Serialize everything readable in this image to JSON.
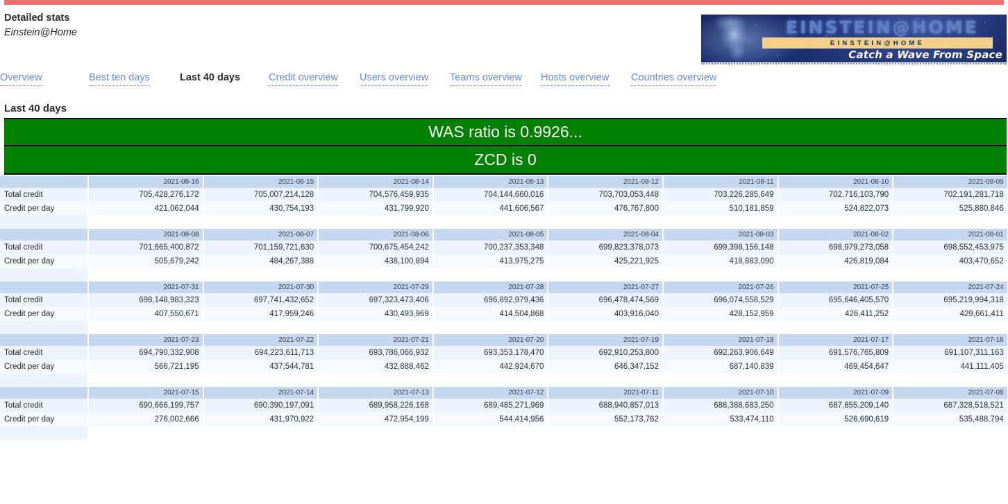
{
  "header": {
    "title": "Detailed stats",
    "subtitle": "Einstein@Home"
  },
  "banner": {
    "wordmark": "EINSTEIN@HOME",
    "bar_text": "EINSTEIN@HOME",
    "tagline": "Catch a Wave From Space"
  },
  "nav": {
    "items": [
      {
        "label": "Overview",
        "active": false
      },
      {
        "label": "Best ten days",
        "active": false
      },
      {
        "label": "Last 40 days",
        "active": true
      },
      {
        "label": "Credit overview",
        "active": false
      },
      {
        "label": "Users overview",
        "active": false
      },
      {
        "label": "Teams overview",
        "active": false
      },
      {
        "label": "Hosts overview",
        "active": false
      },
      {
        "label": "Countries overview",
        "active": false
      }
    ]
  },
  "page_title": "Last 40 days",
  "status_banners": [
    {
      "text": "WAS ratio is 0.9926...",
      "color": "#008000"
    },
    {
      "text": "ZCD is 0",
      "color": "#008000"
    }
  ],
  "table": {
    "row_labels": [
      "Total credit",
      "Credit per day"
    ],
    "blocks": [
      {
        "dates": [
          "2021-08-16",
          "2021-08-15",
          "2021-08-14",
          "2021-08-13",
          "2021-08-12",
          "2021-08-11",
          "2021-08-10",
          "2021-08-09"
        ],
        "total_credit": [
          "705,428,276,172",
          "705,007,214,128",
          "704,576,459,935",
          "704,144,660,016",
          "703,703,053,448",
          "703,226,285,649",
          "702,716,103,790",
          "702,191,281,718"
        ],
        "credit_per_day": [
          "421,062,044",
          "430,754,193",
          "431,799,920",
          "441,606,567",
          "476,767,800",
          "510,181,859",
          "524,822,073",
          "525,880,846"
        ]
      },
      {
        "dates": [
          "2021-08-08",
          "2021-08-07",
          "2021-08-06",
          "2021-08-05",
          "2021-08-04",
          "2021-08-03",
          "2021-08-02",
          "2021-08-01"
        ],
        "total_credit": [
          "701,665,400,872",
          "701,159,721,630",
          "700,675,454,242",
          "700,237,353,348",
          "699,823,378,073",
          "699,398,156,148",
          "698,979,273,058",
          "698,552,453,975"
        ],
        "credit_per_day": [
          "505,679,242",
          "484,267,388",
          "438,100,894",
          "413,975,275",
          "425,221,925",
          "418,883,090",
          "426,819,084",
          "403,470,652"
        ]
      },
      {
        "dates": [
          "2021-07-31",
          "2021-07-30",
          "2021-07-29",
          "2021-07-28",
          "2021-07-27",
          "2021-07-26",
          "2021-07-25",
          "2021-07-24"
        ],
        "total_credit": [
          "698,148,983,323",
          "697,741,432,652",
          "697,323,473,406",
          "696,892,979,436",
          "696,478,474,569",
          "696,074,558,529",
          "695,646,405,570",
          "695,219,994,318"
        ],
        "credit_per_day": [
          "407,550,671",
          "417,959,246",
          "430,493,969",
          "414,504,868",
          "403,916,040",
          "428,152,959",
          "426,411,252",
          "429,661,411"
        ]
      },
      {
        "dates": [
          "2021-07-23",
          "2021-07-22",
          "2021-07-21",
          "2021-07-20",
          "2021-07-19",
          "2021-07-18",
          "2021-07-17",
          "2021-07-16"
        ],
        "total_credit": [
          "694,790,332,908",
          "694,223,611,713",
          "693,786,066,932",
          "693,353,178,470",
          "692,910,253,800",
          "692,263,906,649",
          "691,576,765,809",
          "691,107,311,163"
        ],
        "credit_per_day": [
          "566,721,195",
          "437,544,781",
          "432,888,462",
          "442,924,670",
          "646,347,152",
          "687,140,839",
          "469,454,647",
          "441,111,405"
        ]
      },
      {
        "dates": [
          "2021-07-15",
          "2021-07-14",
          "2021-07-13",
          "2021-07-12",
          "2021-07-11",
          "2021-07-10",
          "2021-07-09",
          "2021-07-08"
        ],
        "total_credit": [
          "690,666,199,757",
          "690,390,197,091",
          "689,958,226,168",
          "689,485,271,969",
          "688,940,857,013",
          "688,388,683,250",
          "687,855,209,140",
          "687,328,518,521"
        ],
        "credit_per_day": [
          "276,002,666",
          "431,970,922",
          "472,954,199",
          "544,414,956",
          "552,173,762",
          "533,474,110",
          "526,690,619",
          "535,488,794"
        ]
      }
    ]
  },
  "colors": {
    "top_rule": "#f4706e",
    "link": "#6688dd",
    "banner_green": "#008000",
    "header_row": "#c6d8ef",
    "row_a": "#eef4fd",
    "row_b": "#f6f9fd"
  }
}
